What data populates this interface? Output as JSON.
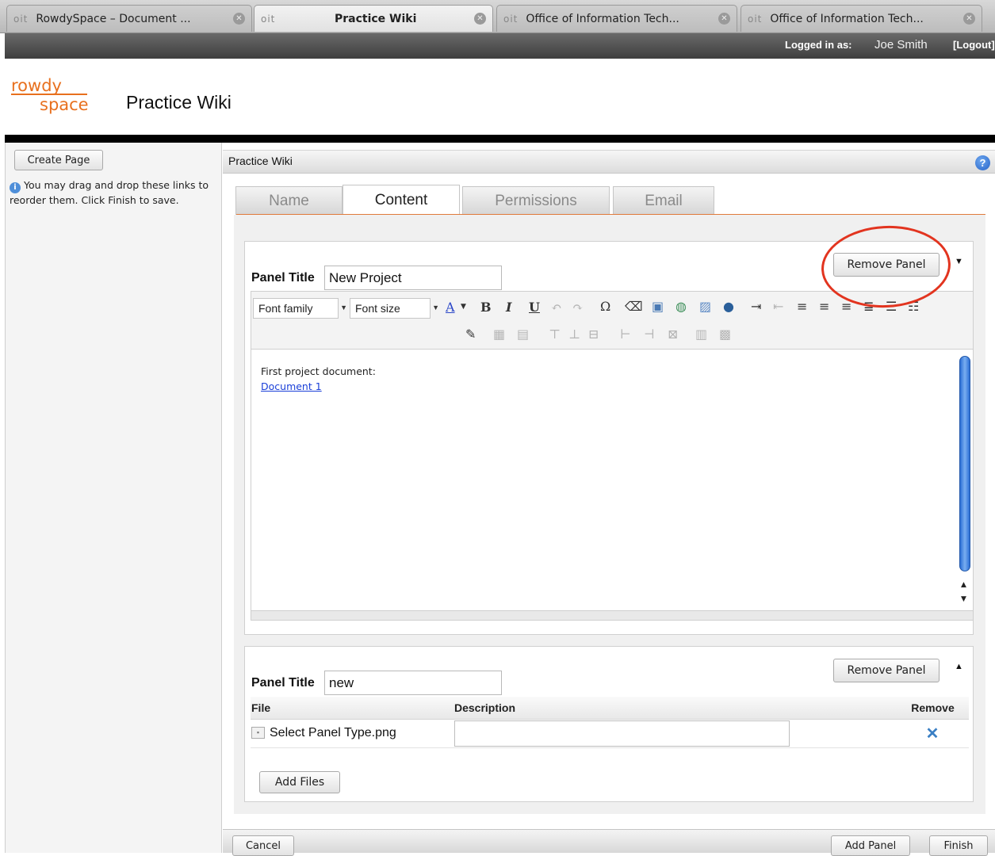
{
  "browser": {
    "tabs": [
      {
        "favicon": "oit",
        "label": "RowdySpace – Document ...",
        "close": "✕"
      },
      {
        "favicon": "oit",
        "label": "Practice Wiki",
        "close": "✕"
      },
      {
        "favicon": "oit",
        "label": "Office of Information Tech...",
        "close": "✕"
      },
      {
        "favicon": "oit",
        "label": "Office of Information Tech...",
        "close": "✕"
      }
    ]
  },
  "userbar": {
    "logged_in_label": "Logged in as:",
    "user_name": "Joe Smith",
    "logout": "[Logout]"
  },
  "header": {
    "logo_top": "rowdy",
    "logo_bottom": "space",
    "site_title": "Practice Wiki"
  },
  "sidebar": {
    "create_page": "Create Page",
    "hint": "You may drag and drop these links to reorder them. Click Finish to save."
  },
  "main": {
    "breadcrumb": "Practice Wiki",
    "help_icon": "?",
    "tabs": [
      {
        "label": "Name"
      },
      {
        "label": "Content"
      },
      {
        "label": "Permissions"
      },
      {
        "label": "Email"
      }
    ],
    "active_tab": "Content"
  },
  "panel1": {
    "remove_label": "Remove Panel",
    "toggle": "▼",
    "title_label": "Panel Title",
    "title_value": "New Project",
    "toolbar": {
      "font_family": "Font family",
      "font_size": "Font size"
    },
    "content_line": "First project document:",
    "content_link": "Document 1"
  },
  "panel2": {
    "remove_label": "Remove Panel",
    "toggle": "▲",
    "title_label": "Panel Title",
    "title_value": "new",
    "columns": [
      "File",
      "Description",
      "Remove"
    ],
    "files": [
      {
        "name": "Select Panel Type.png",
        "description": "",
        "remove": "✕"
      }
    ],
    "add_files": "Add Files"
  },
  "footer": {
    "cancel": "Cancel",
    "add_panel": "Add Panel",
    "finish": "Finish"
  },
  "colors": {
    "accent_orange": "#e8701e",
    "annotation_red": "#e2341f",
    "link_blue": "#1a3fd8",
    "scrollbar_blue": "#2c6fd6"
  }
}
